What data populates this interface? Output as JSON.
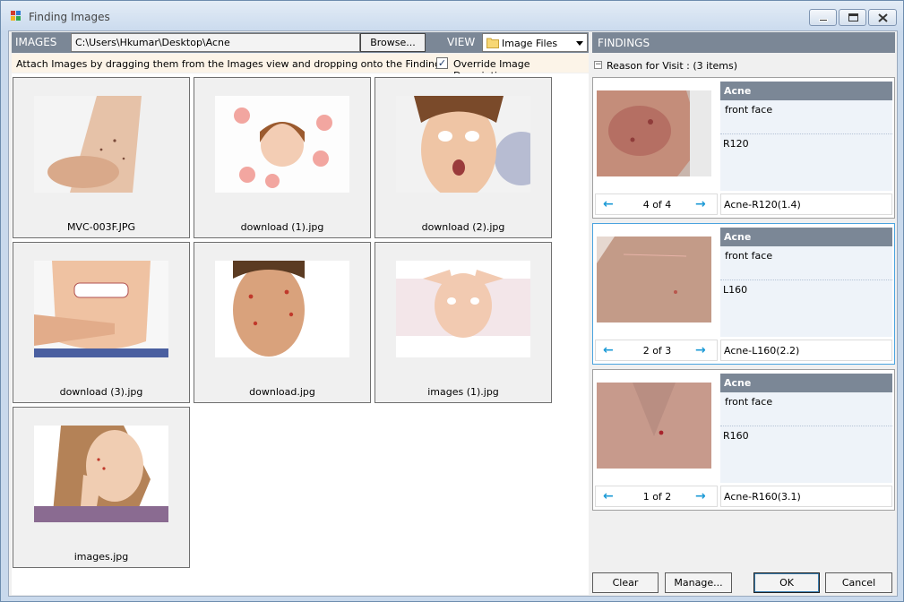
{
  "window": {
    "title": "Finding Images"
  },
  "images_panel": {
    "label": "IMAGES",
    "path": "C:\\Users\\Hkumar\\Desktop\\Acne",
    "browse_label": "Browse...",
    "view_label": "VIEW",
    "view_value": "Image Files",
    "hint": "Attach Images by dragging them from the Images view and dropping onto the Findings",
    "override_checked": true,
    "override_label": "Override Image Description"
  },
  "images": [
    {
      "name": "MVC-003F.JPG"
    },
    {
      "name": "download (1).jpg"
    },
    {
      "name": "download (2).jpg"
    },
    {
      "name": "download (3).jpg"
    },
    {
      "name": "download.jpg"
    },
    {
      "name": "images (1).jpg"
    },
    {
      "name": "images.jpg"
    }
  ],
  "findings_panel": {
    "label": "FINDINGS",
    "group_text": "Reason for Visit :  (3 items)"
  },
  "findings": [
    {
      "title": "Acne",
      "location": "front face",
      "code": "R120",
      "counter": "4 of 4",
      "label": "Acne-R120(1.4)"
    },
    {
      "title": "Acne",
      "location": "front face",
      "code": "L160",
      "counter": "2 of 3",
      "label": "Acne-L160(2.2)"
    },
    {
      "title": "Acne",
      "location": "front face",
      "code": "R160",
      "counter": "1 of 2",
      "label": "Acne-R160(3.1)"
    }
  ],
  "buttons": {
    "clear": "Clear",
    "manage": "Manage...",
    "ok": "OK",
    "cancel": "Cancel"
  },
  "icons": {
    "prev": "←",
    "next": "→",
    "check": "✓",
    "collapse": "−"
  },
  "colors": {
    "header_bar": "#7b8796",
    "nav_arrow": "#1c9ad6",
    "selected_border": "#4aa3df"
  }
}
